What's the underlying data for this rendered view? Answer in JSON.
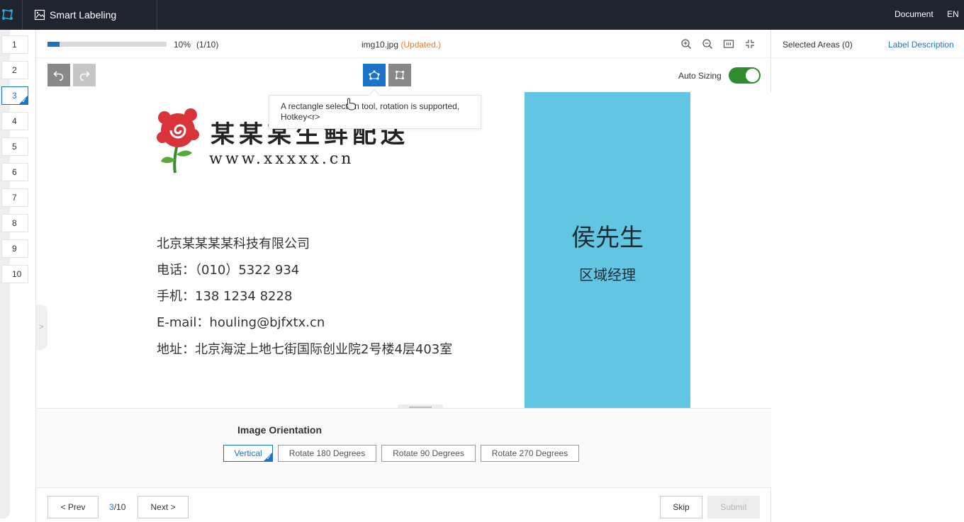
{
  "app": {
    "title": "Smart Labeling",
    "document_link": "Document",
    "language": "EN",
    "logo_icon": "labeling-logo-icon",
    "image_icon": "image-icon"
  },
  "thumbnails": [
    {
      "label": "1",
      "active": false
    },
    {
      "label": "2",
      "active": false
    },
    {
      "label": "3",
      "active": true,
      "checked": true
    },
    {
      "label": "4",
      "active": false
    },
    {
      "label": "5",
      "active": false
    },
    {
      "label": "6",
      "active": false
    },
    {
      "label": "7",
      "active": false
    },
    {
      "label": "8",
      "active": false
    },
    {
      "label": "9",
      "active": false
    },
    {
      "label": "10",
      "active": false
    }
  ],
  "progress": {
    "percent_label": "10%",
    "count_label": "(1/10)",
    "fraction": 0.1
  },
  "file": {
    "name": "img10.jpg",
    "status": "(Updated.)"
  },
  "view_tools": [
    "zoom-in-icon",
    "zoom-out-icon",
    "fit-to-screen-icon",
    "collapse-icon"
  ],
  "toolbar": {
    "undo_icon": "undo-icon",
    "redo_icon": "redo-icon",
    "polygon_tool_icon": "polygon-select-icon",
    "rect_tool_icon": "rotated-rect-icon",
    "auto_sizing_label": "Auto Sizing",
    "auto_sizing_on": true
  },
  "tooltip": {
    "text": "A rectangle selection tool, rotation is supported, Hotkey<r>"
  },
  "card": {
    "company_banner": "某某某生鲜配送",
    "website": "www.xxxxx.cn",
    "lines": [
      "北京某某某某科技有限公司",
      "电话：（010）5322 934",
      "手机：138 1234 8228",
      "E-mail：houling@bjfxtx.cn",
      "地址：北京海淀上地七街国际创业院2号楼4层403室"
    ],
    "name": "侯先生",
    "position": "区域经理",
    "panel_color": "#62c5e2"
  },
  "orientation": {
    "title": "Image Orientation",
    "options": [
      "Vertical",
      "Rotate 180 Degrees",
      "Rotate 90 Degrees",
      "Rotate 270 Degrees"
    ],
    "selected": "Vertical"
  },
  "footer": {
    "prev_label": "< Prev",
    "page_current": "3",
    "page_total": "/10",
    "next_label": "Next >",
    "skip_label": "Skip",
    "submit_label": "Submit"
  },
  "right_panel": {
    "selected_areas": "Selected Areas (0)",
    "label_description": "Label Description"
  },
  "colors": {
    "accent": "#1a73c8",
    "topbar": "#20242e",
    "status_updated": "#f07a2a",
    "toggle_on": "#2e8b2e"
  }
}
